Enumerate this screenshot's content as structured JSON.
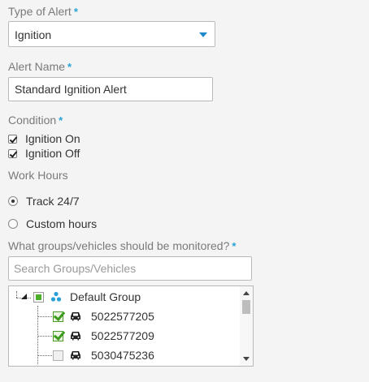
{
  "alert_type": {
    "label": "Type of Alert",
    "required_mark": "*",
    "value": "Ignition"
  },
  "alert_name": {
    "label": "Alert Name",
    "required_mark": "*",
    "value": "Standard Ignition Alert"
  },
  "condition": {
    "label": "Condition",
    "required_mark": "*",
    "options": [
      {
        "label": "Ignition On",
        "checked": true
      },
      {
        "label": "Ignition Off",
        "checked": true
      }
    ]
  },
  "work_hours": {
    "label": "Work Hours",
    "options": [
      {
        "label": "Track 24/7",
        "selected": true
      },
      {
        "label": "Custom hours",
        "selected": false
      }
    ]
  },
  "monitoring": {
    "label": "What groups/vehicles should be monitored?",
    "required_mark": "*",
    "search_placeholder": "Search Groups/Vehicles",
    "tree": {
      "group": {
        "label": "Default Group",
        "icon": "group-icon",
        "state": "partial"
      },
      "vehicles": [
        {
          "label": "5022577205",
          "icon": "car-icon",
          "checked": true
        },
        {
          "label": "5022577209",
          "icon": "car-icon",
          "checked": true
        },
        {
          "label": "5030475236",
          "icon": "car-icon",
          "checked": false
        }
      ]
    }
  },
  "colors": {
    "accent": "#29a3d6",
    "check_green": "#3d9a1f"
  }
}
